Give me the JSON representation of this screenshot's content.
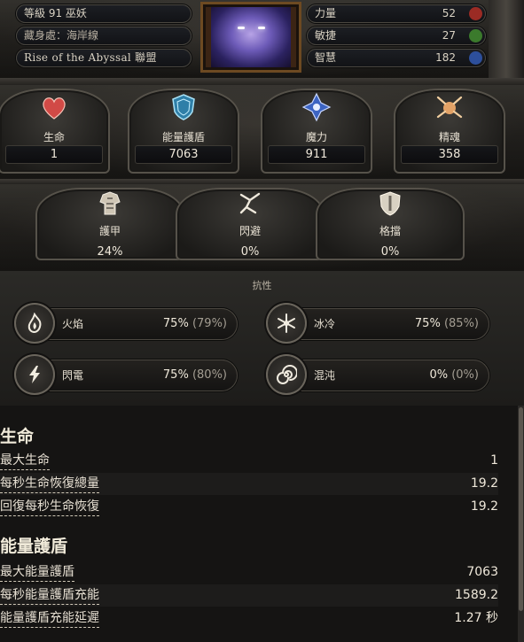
{
  "header": {
    "level_class": "等級 91 巫妖",
    "hideout": "藏身處：海岸線",
    "league": "Rise of the Abyssal 聯盟",
    "attributes": [
      {
        "label": "力量",
        "value": "52",
        "color": "#9b2b24"
      },
      {
        "label": "敏捷",
        "value": "27",
        "color": "#3b7a2c"
      },
      {
        "label": "智慧",
        "value": "182",
        "color": "#2d4f9b"
      }
    ]
  },
  "stats": [
    {
      "label": "生命",
      "value": "1",
      "icon": "heart-icon"
    },
    {
      "label": "能量護盾",
      "value": "7063",
      "icon": "energy-shield-icon"
    },
    {
      "label": "魔力",
      "value": "911",
      "icon": "mana-icon"
    },
    {
      "label": "精魂",
      "value": "358",
      "icon": "spirit-icon"
    }
  ],
  "defences": [
    {
      "label": "護甲",
      "value": "24%",
      "icon": "armour-icon"
    },
    {
      "label": "閃避",
      "value": "0%",
      "icon": "evasion-icon"
    },
    {
      "label": "格擋",
      "value": "0%",
      "icon": "block-icon"
    }
  ],
  "resistances": {
    "title": "抗性",
    "items": [
      {
        "label": "火焰",
        "value": "75%",
        "cap": "(79%)",
        "icon": "fire-icon"
      },
      {
        "label": "冰冷",
        "value": "75%",
        "cap": "(85%)",
        "icon": "cold-icon"
      },
      {
        "label": "閃電",
        "value": "75%",
        "cap": "(80%)",
        "icon": "lightning-icon"
      },
      {
        "label": "混沌",
        "value": "0%",
        "cap": "(0%)",
        "icon": "chaos-icon"
      }
    ]
  },
  "life_section": {
    "title": "生命",
    "rows": [
      {
        "label": "最大生命",
        "value": "1"
      },
      {
        "label": "每秒生命恢復總量",
        "value": "19.2"
      },
      {
        "label": "回復每秒生命恢復",
        "value": "19.2"
      }
    ]
  },
  "es_section": {
    "title": "能量護盾",
    "rows": [
      {
        "label": "最大能量護盾",
        "value": "7063"
      },
      {
        "label": "每秒能量護盾充能",
        "value": "1589.2"
      },
      {
        "label": "能量護盾充能延遲",
        "value": "1.27 秒"
      }
    ]
  }
}
